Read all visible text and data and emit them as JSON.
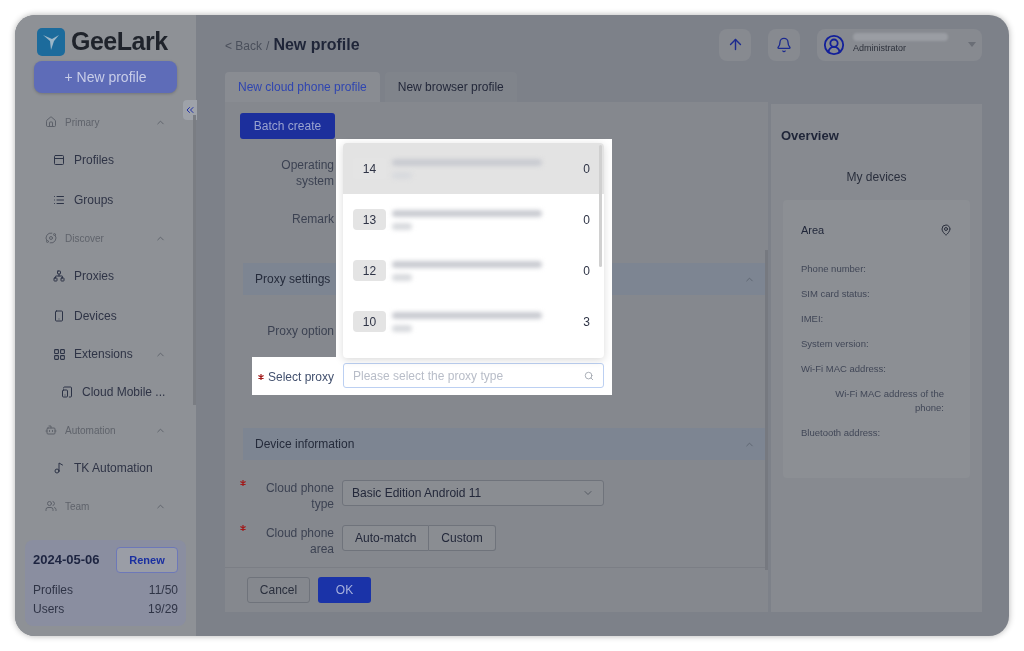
{
  "sidebar": {
    "logo": "GeeLark",
    "new_button": "+ New profile",
    "items": [
      {
        "kind": "section",
        "label": "Primary",
        "expanded": true
      },
      {
        "kind": "item",
        "label": "Profiles"
      },
      {
        "kind": "item",
        "label": "Groups"
      },
      {
        "kind": "section",
        "label": "Discover",
        "expanded": true
      },
      {
        "kind": "item",
        "label": "Proxies"
      },
      {
        "kind": "item",
        "label": "Devices"
      },
      {
        "kind": "group",
        "label": "Extensions",
        "expanded": true
      },
      {
        "kind": "subitem",
        "label": "Cloud Mobile ..."
      },
      {
        "kind": "section",
        "label": "Automation",
        "expanded": true
      },
      {
        "kind": "item",
        "label": "TK Automation"
      },
      {
        "kind": "section",
        "label": "Team",
        "expanded": true
      }
    ],
    "plan": {
      "date": "2024-05-06",
      "renew": "Renew",
      "stats": [
        {
          "label": "Profiles",
          "value": "11/50"
        },
        {
          "label": "Users",
          "value": "19/29"
        }
      ]
    }
  },
  "header": {
    "back": "< Back",
    "separator": "/",
    "title": "New profile",
    "user_role": "Administrator"
  },
  "tabs": [
    {
      "label": "New cloud phone profile",
      "selected": true
    },
    {
      "label": "New browser profile",
      "selected": false
    }
  ],
  "form": {
    "batch_button": "Batch create",
    "rows_top": [
      {
        "label": "Operating system"
      },
      {
        "label": "Remark"
      }
    ],
    "proxy_section": "Proxy settings",
    "proxy_option": "Proxy option",
    "select_proxy": {
      "label": "Select proxy",
      "required": true,
      "placeholder": "Please select the proxy type"
    },
    "proxy_list": [
      {
        "number": "14",
        "count": "0",
        "selected": true
      },
      {
        "number": "13",
        "count": "0",
        "selected": false
      },
      {
        "number": "12",
        "count": "0",
        "selected": false
      },
      {
        "number": "10",
        "count": "3",
        "selected": false
      }
    ],
    "device_section": "Device information",
    "phone_type": {
      "label": "Cloud phone type",
      "required": true,
      "value": "Basic Edition Android 11"
    },
    "phone_area": {
      "label": "Cloud phone area",
      "required": true,
      "options": [
        "Auto-match",
        "Custom"
      ]
    },
    "cancel": "Cancel",
    "ok": "OK"
  },
  "overview": {
    "title": "Overview",
    "subtitle": "My devices",
    "area": "Area",
    "fields": [
      "Phone number:",
      "SIM card status:",
      "IMEI:",
      "System version:",
      "Wi-Fi MAC address:",
      "Wi-Fi MAC address of the phone:",
      "Bluetooth address:"
    ]
  }
}
